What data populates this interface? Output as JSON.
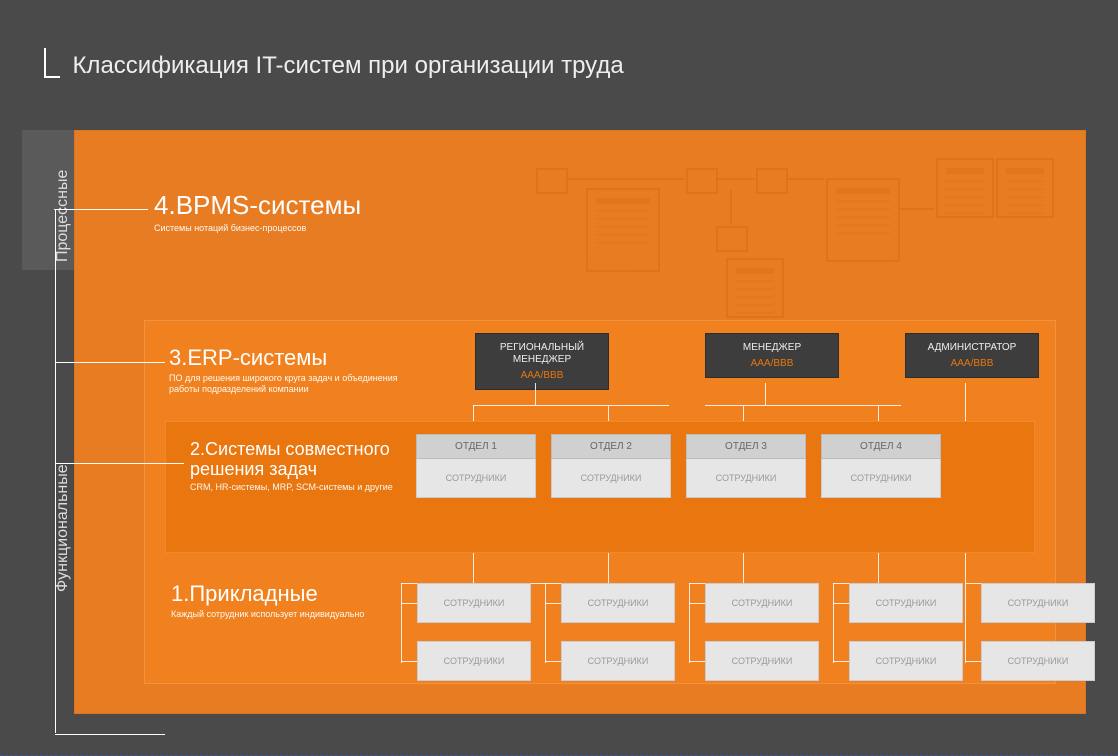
{
  "title": "Классификация IT-систем при организации труда",
  "axis": {
    "process": "Процессные",
    "functional": "Функциональные"
  },
  "levels": {
    "l4": {
      "num": "4.",
      "title": "BPMS-системы",
      "sub": "Системы нотаций бизнес-процессов"
    },
    "l3": {
      "num": "3.",
      "title": "ERP-системы",
      "sub": "ПО для решения широкого круга задач и объединения работы подразделений компании"
    },
    "l2": {
      "num": "2.",
      "title": "Системы совместного решения задач",
      "sub": "CRM, HR-системы, MRP, SCM-системы и другие"
    },
    "l1": {
      "num": "1.",
      "title": "Прикладные",
      "sub": "Каждый сотрудник использует индивидуально"
    }
  },
  "managers": [
    {
      "role": "РЕГИОНАЛЬНЫЙ МЕНЕДЖЕР",
      "code": "AAA/BBB"
    },
    {
      "role": "МЕНЕДЖЕР",
      "code": "AAA/BBB"
    },
    {
      "role": "АДМИНИСТРАТОР",
      "code": "AAA/BBB"
    }
  ],
  "departments": [
    {
      "name": "ОТДЕЛ 1",
      "staff": "СОТРУДНИКИ"
    },
    {
      "name": "ОТДЕЛ 2",
      "staff": "СОТРУДНИКИ"
    },
    {
      "name": "ОТДЕЛ 3",
      "staff": "СОТРУДНИКИ"
    },
    {
      "name": "ОТДЕЛ 4",
      "staff": "СОТРУДНИКИ"
    }
  ],
  "level1_staff_label": "СОТРУДНИКИ",
  "colors": {
    "brand": "#E77C22",
    "brand_inner": "#F0811E",
    "brand_deep": "#E9760E",
    "box_dark": "#3d3d3d",
    "box_light": "#e6e6e6"
  }
}
